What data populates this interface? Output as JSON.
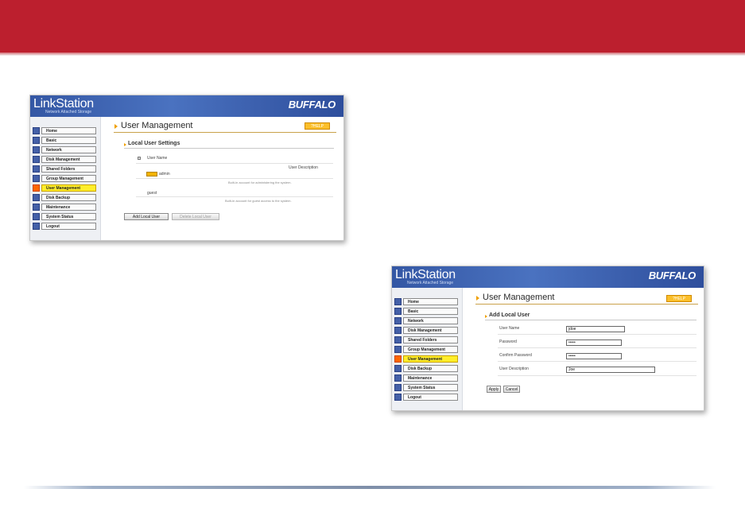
{
  "colors": {
    "header_band": "#bc1f2e",
    "accent": "#f0a000",
    "nav_active": "#ffee2a",
    "help_button": "#fbbf2a"
  },
  "branding": {
    "product": "LinkStation",
    "tagline": "Network Attached Storage",
    "vendor": "BUFFALO"
  },
  "nav": [
    "Home",
    "Basic",
    "Network",
    "Disk Management",
    "Shared Folders",
    "Group Management",
    "User Management",
    "Disk Backup",
    "Maintenance",
    "System Status",
    "Logout"
  ],
  "nav_active": "User Management",
  "help_label": "?HELP",
  "page_title": "User Management",
  "screen1": {
    "section_title": "Local User Settings",
    "col_user_name": "User Name",
    "col_user_description": "User Description",
    "users": [
      {
        "name": "admin",
        "description": "Built-in account for administering the system."
      },
      {
        "name": "guest",
        "description": "Built-in account for guest access to the system."
      }
    ],
    "add_button": "Add Local User",
    "delete_button": "Delete Local User"
  },
  "screen2": {
    "section_title": "Add Local User",
    "fields": [
      {
        "label": "User Name",
        "value": "jdoe"
      },
      {
        "label": "Password",
        "value": "•••••"
      },
      {
        "label": "Confirm Password",
        "value": "•••••"
      },
      {
        "label": "User Description",
        "value": "Joe"
      }
    ],
    "apply_button": "Apply",
    "cancel_button": "Cancel"
  }
}
